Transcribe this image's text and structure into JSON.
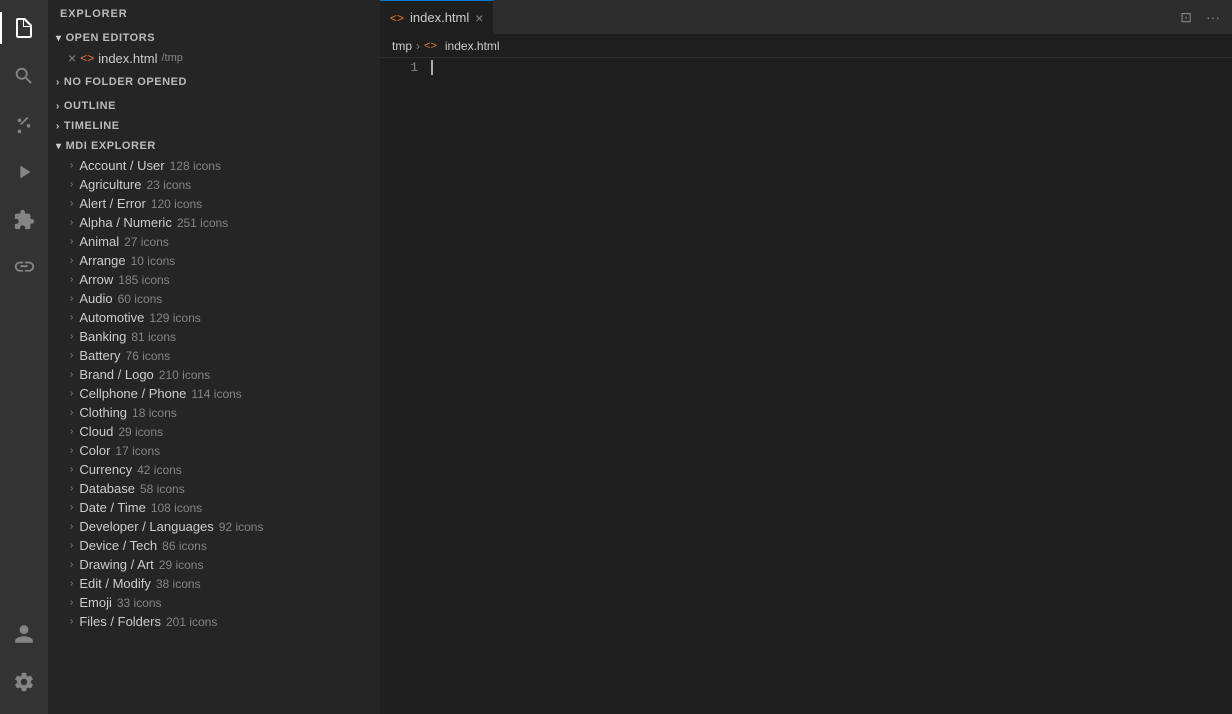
{
  "activityBar": {
    "icons": [
      {
        "name": "files-icon",
        "symbol": "⧉",
        "active": true
      },
      {
        "name": "search-icon",
        "symbol": "🔍",
        "active": false
      },
      {
        "name": "source-control-icon",
        "symbol": "⎇",
        "active": false
      },
      {
        "name": "run-icon",
        "symbol": "▶",
        "active": false
      },
      {
        "name": "extensions-icon",
        "symbol": "⊞",
        "active": false
      },
      {
        "name": "remote-icon",
        "symbol": "⊗",
        "active": false
      }
    ],
    "bottomIcons": [
      {
        "name": "account-icon",
        "symbol": "👤"
      },
      {
        "name": "settings-icon",
        "symbol": "⚙"
      }
    ]
  },
  "sidebar": {
    "title": "EXPLORER",
    "sections": {
      "openEditors": {
        "label": "OPEN EDITORS",
        "files": [
          {
            "name": "index.html",
            "path": "/tmp",
            "icon": "<>"
          }
        ]
      },
      "noFolder": {
        "label": "NO FOLDER OPENED"
      },
      "outline": {
        "label": "OUTLINE"
      },
      "timeline": {
        "label": "TIMELINE"
      },
      "mdiExplorer": {
        "label": "MDI EXPLORER",
        "items": [
          {
            "name": "Account / User",
            "count": "128 icons"
          },
          {
            "name": "Agriculture",
            "count": "23 icons"
          },
          {
            "name": "Alert / Error",
            "count": "120 icons"
          },
          {
            "name": "Alpha / Numeric",
            "count": "251 icons"
          },
          {
            "name": "Animal",
            "count": "27 icons"
          },
          {
            "name": "Arrange",
            "count": "10 icons"
          },
          {
            "name": "Arrow",
            "count": "185 icons"
          },
          {
            "name": "Audio",
            "count": "60 icons"
          },
          {
            "name": "Automotive",
            "count": "129 icons"
          },
          {
            "name": "Banking",
            "count": "81 icons"
          },
          {
            "name": "Battery",
            "count": "76 icons"
          },
          {
            "name": "Brand / Logo",
            "count": "210 icons"
          },
          {
            "name": "Cellphone / Phone",
            "count": "114 icons"
          },
          {
            "name": "Clothing",
            "count": "18 icons"
          },
          {
            "name": "Cloud",
            "count": "29 icons"
          },
          {
            "name": "Color",
            "count": "17 icons"
          },
          {
            "name": "Currency",
            "count": "42 icons"
          },
          {
            "name": "Database",
            "count": "58 icons"
          },
          {
            "name": "Date / Time",
            "count": "108 icons"
          },
          {
            "name": "Developer / Languages",
            "count": "92 icons"
          },
          {
            "name": "Device / Tech",
            "count": "86 icons"
          },
          {
            "name": "Drawing / Art",
            "count": "29 icons"
          },
          {
            "name": "Edit / Modify",
            "count": "38 icons"
          },
          {
            "name": "Emoji",
            "count": "33 icons"
          },
          {
            "name": "Files / Folders",
            "count": "201 icons"
          }
        ]
      }
    }
  },
  "editor": {
    "tabs": [
      {
        "label": "index.html",
        "icon": "<>",
        "active": true,
        "closeable": true
      }
    ],
    "breadcrumb": {
      "parts": [
        "tmp",
        "index.html"
      ]
    },
    "lineNumber": "1",
    "content": ""
  }
}
